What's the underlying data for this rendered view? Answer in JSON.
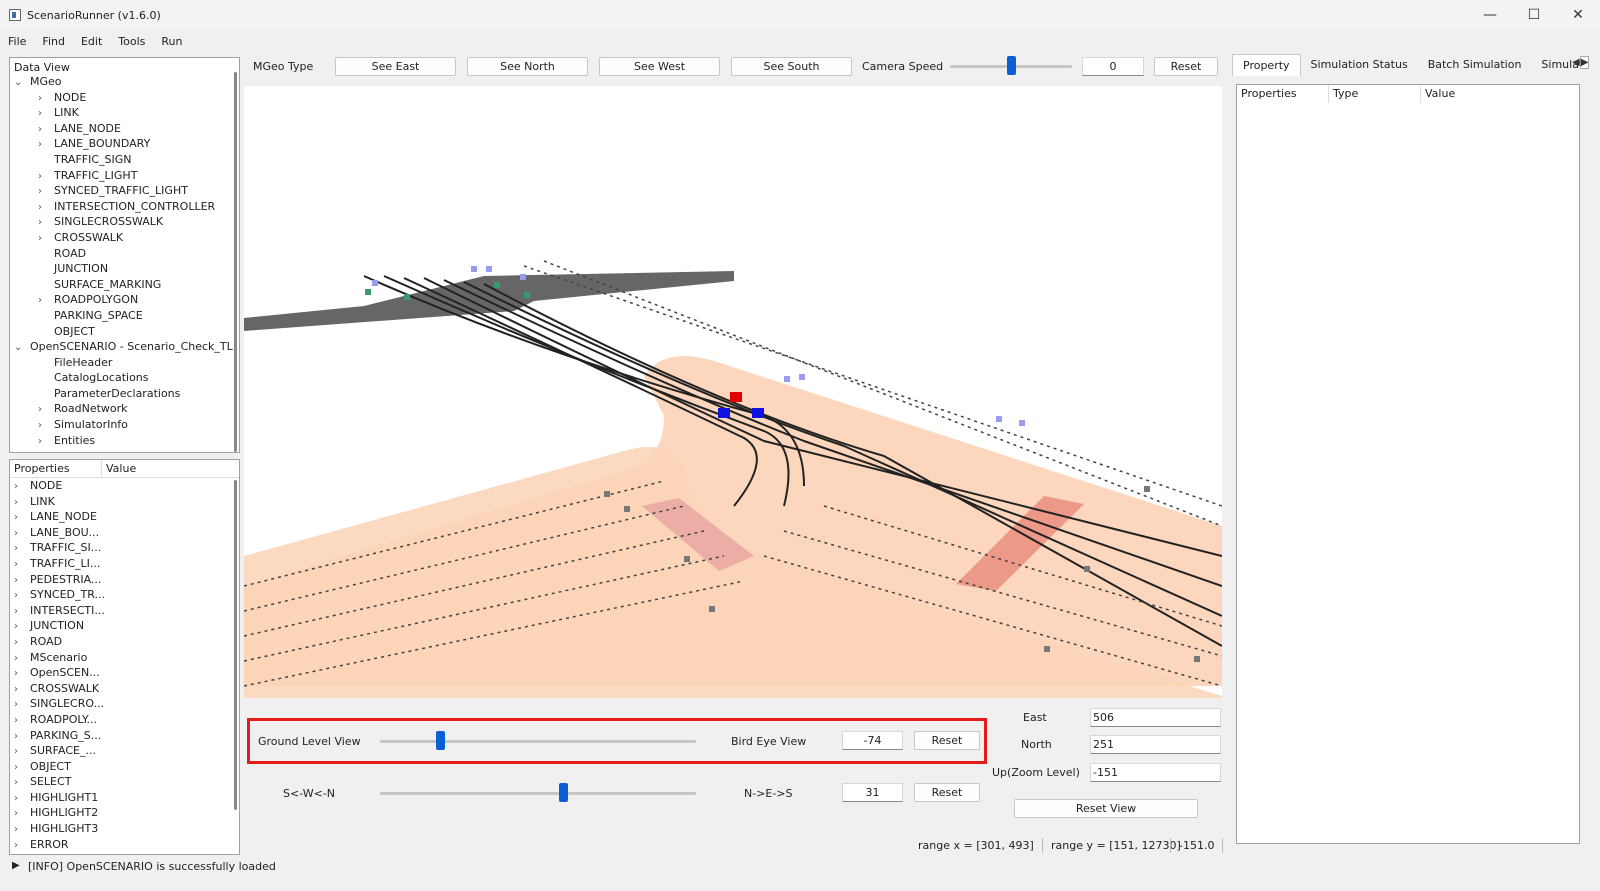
{
  "window": {
    "title": "ScenarioRunner (v1.6.0)",
    "minimize": "—",
    "maximize": "☐",
    "close": "✕"
  },
  "menu": [
    "File",
    "Find",
    "Edit",
    "Tools",
    "Run"
  ],
  "data_view": {
    "title": "Data View",
    "items": [
      {
        "label": "MGeo",
        "level": 0,
        "chevron": "expanded"
      },
      {
        "label": "NODE",
        "level": 1,
        "chevron": "collapsed"
      },
      {
        "label": "LINK",
        "level": 1,
        "chevron": "collapsed"
      },
      {
        "label": "LANE_NODE",
        "level": 1,
        "chevron": "collapsed"
      },
      {
        "label": "LANE_BOUNDARY",
        "level": 1,
        "chevron": "collapsed"
      },
      {
        "label": "TRAFFIC_SIGN",
        "level": 1,
        "chevron": "none"
      },
      {
        "label": "TRAFFIC_LIGHT",
        "level": 1,
        "chevron": "collapsed"
      },
      {
        "label": "SYNCED_TRAFFIC_LIGHT",
        "level": 1,
        "chevron": "collapsed"
      },
      {
        "label": "INTERSECTION_CONTROLLER",
        "level": 1,
        "chevron": "collapsed"
      },
      {
        "label": "SINGLECROSSWALK",
        "level": 1,
        "chevron": "collapsed"
      },
      {
        "label": "CROSSWALK",
        "level": 1,
        "chevron": "collapsed"
      },
      {
        "label": "ROAD",
        "level": 1,
        "chevron": "none"
      },
      {
        "label": "JUNCTION",
        "level": 1,
        "chevron": "none"
      },
      {
        "label": "SURFACE_MARKING",
        "level": 1,
        "chevron": "none"
      },
      {
        "label": "ROADPOLYGON",
        "level": 1,
        "chevron": "collapsed"
      },
      {
        "label": "PARKING_SPACE",
        "level": 1,
        "chevron": "none"
      },
      {
        "label": "OBJECT",
        "level": 1,
        "chevron": "none"
      },
      {
        "label": "OpenSCENARIO - Scenario_Check_TL",
        "level": 0,
        "chevron": "expanded"
      },
      {
        "label": "FileHeader",
        "level": 1,
        "chevron": "none"
      },
      {
        "label": "CatalogLocations",
        "level": 1,
        "chevron": "none"
      },
      {
        "label": "ParameterDeclarations",
        "level": 1,
        "chevron": "none"
      },
      {
        "label": "RoadNetwork",
        "level": 1,
        "chevron": "collapsed"
      },
      {
        "label": "SimulatorInfo",
        "level": 1,
        "chevron": "collapsed"
      },
      {
        "label": "Entities",
        "level": 1,
        "chevron": "collapsed"
      }
    ]
  },
  "properties_panel": {
    "col1": "Properties",
    "col2": "Value",
    "items": [
      "NODE",
      "LINK",
      "LANE_NODE",
      "LANE_BOU...",
      "TRAFFIC_SI...",
      "TRAFFIC_LI...",
      "PEDESTRIA...",
      "SYNCED_TR...",
      "INTERSECTI...",
      "JUNCTION",
      "ROAD",
      "MScenario",
      "OpenSCEN...",
      "CROSSWALK",
      "SINGLECRO...",
      "ROADPOLY...",
      "PARKING_S...",
      "SURFACE_...",
      "OBJECT",
      "SELECT",
      "HIGHLIGHT1",
      "HIGHLIGHT2",
      "HIGHLIGHT3",
      "ERROR"
    ]
  },
  "toolbar": {
    "mgeo_type": "MGeo Type",
    "see_east": "See East",
    "see_north": "See North",
    "see_west": "See West",
    "see_south": "See South",
    "camera_speed_label": "Camera Speed",
    "camera_speed_value": "0",
    "camera_speed_level": 0.5,
    "reset": "Reset"
  },
  "view_controls": {
    "ground_label": "Ground Level View",
    "bird_label": "Bird Eye View",
    "pitch_value": "-74",
    "pitch_level": 0.19,
    "reset1": "Reset",
    "swn_label": "S<-W<-N",
    "nes_label": "N->E->S",
    "yaw_value": "31",
    "yaw_level": 0.58,
    "reset2": "Reset"
  },
  "coords": {
    "east_label": "East",
    "east_value": "506",
    "north_label": "North",
    "north_value": "251",
    "up_label": "Up(Zoom Level)",
    "up_value": "-151",
    "reset_view": "Reset View"
  },
  "range": {
    "x": "range x = [301, 493]",
    "y": "range y = [151, 12730]",
    "z": "-151.0"
  },
  "right_panel": {
    "tabs": [
      "Property",
      "Simulation Status",
      "Batch Simulation",
      "Simulati"
    ],
    "active_tab": "Property",
    "cols": [
      "Properties",
      "Type",
      "Value"
    ]
  },
  "status": {
    "message": "[INFO] OpenSCENARIO is successfully loaded"
  },
  "colors": {
    "accent": "#0a5fd6",
    "road": "#fcd3b6",
    "highlight": "#e31b1b"
  }
}
